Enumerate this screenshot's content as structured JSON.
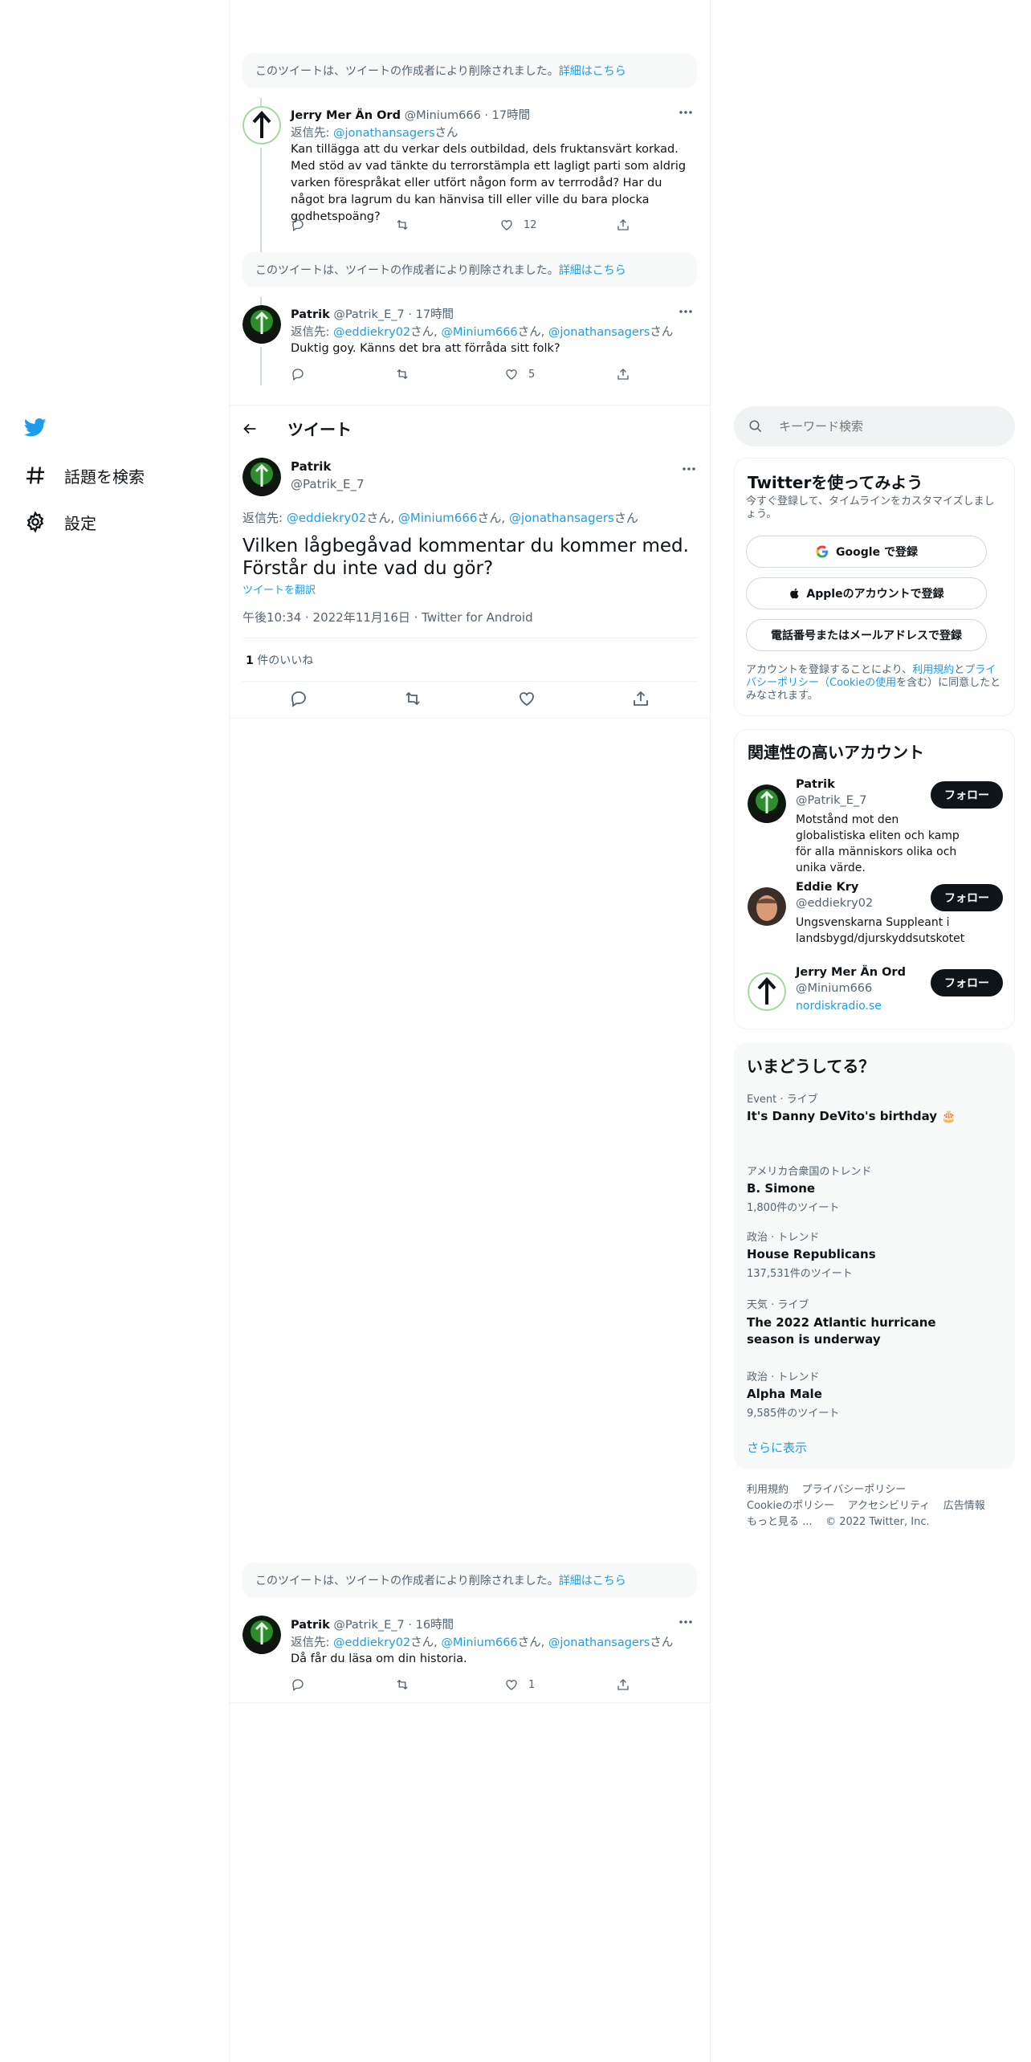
{
  "nav": {
    "explore_label": "話題を検索",
    "settings_label": "設定"
  },
  "deleted_notice": {
    "text": "このツイートは、ツイートの作成者により削除されました。",
    "link": "詳細はこちら"
  },
  "replies_above": [
    {
      "name": "Jerry Mer Än Ord",
      "handle_time": "@Minium666 · 17時間",
      "reply_prefix": "返信先: ",
      "reply_to": [
        {
          "handle": "@jonathansagers",
          "suffix": "さん"
        }
      ],
      "text": "Kan tillägga att du verkar dels outbildad, dels fruktansvärt korkad. Med stöd av vad tänkte du terrorstämpla ett lagligt parti som aldrig varken förespråkat eller utfört någon form av terrrodåd? Har du något bra lagrum du kan hänvisa till eller ville du bara plocka godhetspoäng?",
      "likes": "12"
    },
    {
      "name": "Patrik",
      "handle_time": "@Patrik_E_7 · 17時間",
      "reply_prefix": "返信先: ",
      "reply_to": [
        {
          "handle": "@eddiekry02",
          "suffix": "さん, "
        },
        {
          "handle": "@Minium666",
          "suffix": "さん, "
        },
        {
          "handle": "@jonathansagers",
          "suffix": "さん"
        }
      ],
      "text": "Duktig goy. Känns det bra att förråda sitt folk?",
      "likes": "5"
    }
  ],
  "header": {
    "title": "ツイート"
  },
  "main_tweet": {
    "name": "Patrik",
    "handle": "@Patrik_E_7",
    "reply_prefix": "返信先: ",
    "reply_to": [
      {
        "handle": "@eddiekry02",
        "suffix": "さん, "
      },
      {
        "handle": "@Minium666",
        "suffix": "さん, "
      },
      {
        "handle": "@jonathansagers",
        "suffix": "さん"
      }
    ],
    "text": "Vilken lågbegåvad kommentar du kommer med. Förstår du inte vad du gör?",
    "translate": "ツイートを翻訳",
    "meta": "午後10:34 · 2022年11月16日 · Twitter for Android",
    "likes_count": "1",
    "likes_label": " 件のいいね"
  },
  "reply_below": {
    "name": "Patrik",
    "handle_time": "@Patrik_E_7 · 16時間",
    "reply_prefix": "返信先: ",
    "reply_to": [
      {
        "handle": "@eddiekry02",
        "suffix": "さん, "
      },
      {
        "handle": "@Minium666",
        "suffix": "さん, "
      },
      {
        "handle": "@jonathansagers",
        "suffix": "さん"
      }
    ],
    "text": "Då får du läsa om din historia.",
    "likes": "1"
  },
  "search": {
    "placeholder": "キーワード検索"
  },
  "signup": {
    "title": "Twitterを使ってみよう",
    "subtitle": "今すぐ登録して、タイムラインをカスタマイズしましょう。",
    "google": "Google で登録",
    "apple": "Appleのアカウントで登録",
    "phone": "電話番号またはメールアドレスで登録",
    "legal_1": "アカウントを登録することにより、",
    "legal_terms": "利用規約",
    "legal_2": "と",
    "legal_privacy": "プライバシーポリシー（Cookieの使用",
    "legal_3": "を含む）に同意したとみなされます。"
  },
  "related": {
    "title": "関連性の高いアカウント",
    "follow_label": "フォロー",
    "accounts": [
      {
        "name": "Patrik",
        "handle": "@Patrik_E_7",
        "bio": "Motstånd mot den globalistiska eliten och kamp för alla människors olika och unika värde."
      },
      {
        "name": "Eddie Kry",
        "handle": "@eddiekry02",
        "bio": "Ungsvenskarna Suppleant i landsbygd/djurskyddsutskotet"
      },
      {
        "name": "Jerry Mer Än Ord",
        "handle": "@Minium666",
        "bio": "nordiskradio.se"
      }
    ]
  },
  "trends": {
    "title": "いまどうしてる？",
    "items": [
      {
        "meta": "Event · ライブ",
        "title": "It's Danny DeVito's birthday 🎂",
        "count": ""
      },
      {
        "meta": "アメリカ合衆国のトレンド",
        "title": "B. Simone",
        "count": "1,800件のツイート"
      },
      {
        "meta": "政治 · トレンド",
        "title": "House Republicans",
        "count": "137,531件のツイート"
      },
      {
        "meta": "天気 · ライブ",
        "title": "The 2022 Atlantic hurricane season is underway",
        "count": ""
      },
      {
        "meta": "政治 · トレンド",
        "title": "Alpha Male",
        "count": "9,585件のツイート"
      }
    ],
    "show_more": "さらに表示"
  },
  "footer": {
    "terms": "利用規約",
    "privacy": "プライバシーポリシー",
    "cookie": "Cookieのポリシー",
    "accessibility": "アクセシビリティ",
    "ads": "広告情報",
    "more": "もっと見る ...",
    "copyright": "© 2022 Twitter, Inc."
  },
  "colors": {
    "accent": "#1d9bf0",
    "text": "#0f1419",
    "muted": "#536471",
    "panel_bg": "#f7f9f9"
  }
}
